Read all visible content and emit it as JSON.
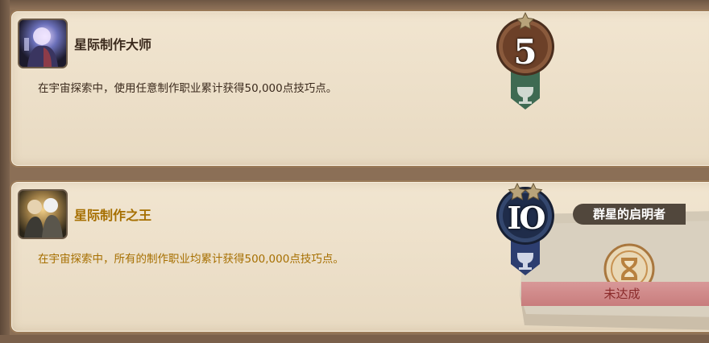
{
  "achievements": [
    {
      "title": "星际制作大师",
      "description": "在宇宙探索中，使用任意制作职业累计获得50,000点技巧点。",
      "points": "5",
      "stars": 1,
      "icon": "crafter-portrait-icon"
    },
    {
      "title": "星际制作之王",
      "description": "在宇宙探索中，所有的制作职业均累计获得500,000点技巧点。",
      "points": "IO",
      "stars": 2,
      "icon": "crafter-duo-portrait-icon",
      "reward": {
        "title": "群星的启明者",
        "status": "未达成",
        "icon": "hourglass-emblem-icon"
      }
    }
  ],
  "colors": {
    "completed_text": "#3b2a1d",
    "incomplete_text": "#a66f00",
    "medal_bronze": "#7a4a30",
    "medal_blue": "#2c3f66",
    "status_bar": "#c87c7c"
  }
}
